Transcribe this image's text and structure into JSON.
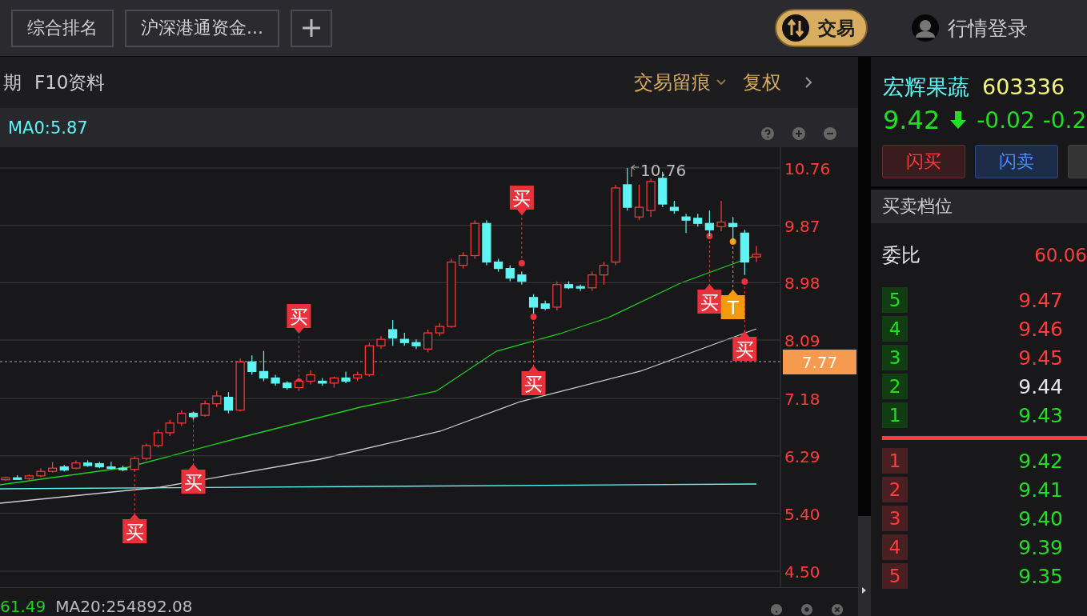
{
  "top_tabs": [
    {
      "label": "综合排名"
    },
    {
      "label": "沪深港通资金..."
    }
  ],
  "trade_button": {
    "label": "交易"
  },
  "login": {
    "label": "行情登录"
  },
  "toolbar": {
    "left": [
      "期",
      "F10资料"
    ],
    "right": [
      {
        "label": "交易留痕",
        "kind": "dropdown"
      },
      {
        "label": "复权",
        "kind": "plain"
      }
    ]
  },
  "indicator_line": "MA0:5.87",
  "chart": {
    "high_label": "10.76",
    "price_tag": "7.77",
    "markers": [
      {
        "kind": "buy",
        "text": "买"
      },
      {
        "kind": "buy",
        "text": "买"
      },
      {
        "kind": "buy",
        "text": "买"
      },
      {
        "kind": "buy",
        "text": "买"
      },
      {
        "kind": "buy",
        "text": "买"
      },
      {
        "kind": "buy",
        "text": "买"
      },
      {
        "kind": "t",
        "text": "T"
      },
      {
        "kind": "buy",
        "text": "买"
      }
    ],
    "chart_data": {
      "type": "candlestick",
      "grid": true,
      "ylim": [
        4.5,
        10.76
      ],
      "yticks": [
        10.76,
        9.87,
        8.98,
        8.09,
        7.18,
        6.29,
        {
          "value": 5.4,
          "label": "5.40"
        },
        {
          "value": 4.5,
          "label": "4.50"
        }
      ],
      "ohlc": [
        [
          5.92,
          5.97,
          5.9,
          5.95
        ],
        [
          5.95,
          5.99,
          5.93,
          5.93
        ],
        [
          5.94,
          6.0,
          5.92,
          5.98
        ],
        [
          5.98,
          6.1,
          5.96,
          6.05
        ],
        [
          6.05,
          6.2,
          6.03,
          6.1
        ],
        [
          6.12,
          6.15,
          6.05,
          6.07
        ],
        [
          6.1,
          6.22,
          6.08,
          6.18
        ],
        [
          6.18,
          6.22,
          6.12,
          6.14
        ],
        [
          6.17,
          6.2,
          6.1,
          6.12
        ],
        [
          6.12,
          6.2,
          6.08,
          6.1
        ],
        [
          6.1,
          6.14,
          6.05,
          6.08
        ],
        [
          6.08,
          6.28,
          6.05,
          6.25
        ],
        [
          6.25,
          6.48,
          6.22,
          6.45
        ],
        [
          6.45,
          6.7,
          6.42,
          6.65
        ],
        [
          6.65,
          6.85,
          6.6,
          6.8
        ],
        [
          6.8,
          7.0,
          6.75,
          6.95
        ],
        [
          6.95,
          6.98,
          6.85,
          6.9
        ],
        [
          6.92,
          7.15,
          6.9,
          7.1
        ],
        [
          7.1,
          7.3,
          7.05,
          7.22
        ],
        [
          7.2,
          7.28,
          6.95,
          7.0
        ],
        [
          7.0,
          7.8,
          6.98,
          7.75
        ],
        [
          7.75,
          7.85,
          7.55,
          7.6
        ],
        [
          7.6,
          7.92,
          7.45,
          7.5
        ],
        [
          7.5,
          7.55,
          7.38,
          7.42
        ],
        [
          7.42,
          7.45,
          7.32,
          7.35
        ],
        [
          7.35,
          7.5,
          7.3,
          7.45
        ],
        [
          7.45,
          7.62,
          7.4,
          7.55
        ],
        [
          7.45,
          7.5,
          7.38,
          7.42
        ],
        [
          7.42,
          7.52,
          7.35,
          7.5
        ],
        [
          7.5,
          7.6,
          7.42,
          7.45
        ],
        [
          7.5,
          7.6,
          7.45,
          7.55
        ],
        [
          7.55,
          8.05,
          7.52,
          8.0
        ],
        [
          8.0,
          8.15,
          7.95,
          8.1
        ],
        [
          8.25,
          8.4,
          8.0,
          8.12
        ],
        [
          8.1,
          8.2,
          8.0,
          8.05
        ],
        [
          8.05,
          8.1,
          7.95,
          8.0
        ],
        [
          7.95,
          8.25,
          7.9,
          8.2
        ],
        [
          8.2,
          8.35,
          8.15,
          8.3
        ],
        [
          8.3,
          9.35,
          8.28,
          9.3
        ],
        [
          9.25,
          9.45,
          9.2,
          9.4
        ],
        [
          9.4,
          9.95,
          9.35,
          9.9
        ],
        [
          9.9,
          9.95,
          9.25,
          9.3
        ],
        [
          9.3,
          9.35,
          9.15,
          9.2
        ],
        [
          9.2,
          9.25,
          9.0,
          9.05
        ],
        [
          9.1,
          9.15,
          8.95,
          9.0
        ],
        [
          8.75,
          8.8,
          8.5,
          8.6
        ],
        [
          8.65,
          8.7,
          8.55,
          8.58
        ],
        [
          8.6,
          9.0,
          8.55,
          8.95
        ],
        [
          8.95,
          9.0,
          8.88,
          8.9
        ],
        [
          8.92,
          8.95,
          8.85,
          8.9
        ],
        [
          8.9,
          9.15,
          8.85,
          9.1
        ],
        [
          9.1,
          9.3,
          8.95,
          9.25
        ],
        [
          9.3,
          10.5,
          9.25,
          10.45
        ],
        [
          10.5,
          10.76,
          10.1,
          10.15
        ],
        [
          10.0,
          10.5,
          9.95,
          10.15
        ],
        [
          10.1,
          10.6,
          10.0,
          10.55
        ],
        [
          10.6,
          10.7,
          10.15,
          10.2
        ],
        [
          10.15,
          10.25,
          10.05,
          10.1
        ],
        [
          10.0,
          10.05,
          9.75,
          9.95
        ],
        [
          9.98,
          10.05,
          9.85,
          9.9
        ],
        [
          9.9,
          10.1,
          9.7,
          9.8
        ],
        [
          9.85,
          10.25,
          9.78,
          9.92
        ],
        [
          9.9,
          10.0,
          9.6,
          9.85
        ],
        [
          9.75,
          9.8,
          9.1,
          9.3
        ],
        [
          9.38,
          9.55,
          9.3,
          9.42
        ]
      ]
    }
  },
  "bottom_indicator": {
    "value": "61.49",
    "ma20": "MA20:254892.08"
  },
  "quote": {
    "name": "宏辉果蔬",
    "code": "603336",
    "price": "9.42",
    "change": "-0.02",
    "change_pct": "-0.2"
  },
  "buttons": [
    {
      "label": "闪买",
      "kind": "buy"
    },
    {
      "label": "闪卖",
      "kind": "sell"
    },
    {
      "kind": "more"
    }
  ],
  "order_book": {
    "title": "买卖档位",
    "ratio_label": "委比",
    "ratio": "60.06",
    "asks": [
      {
        "rank": "5",
        "price": "9.47",
        "color": "#ff3b3b"
      },
      {
        "rank": "4",
        "price": "9.46",
        "color": "#ff3b3b"
      },
      {
        "rank": "3",
        "price": "9.45",
        "color": "#ff3b3b"
      },
      {
        "rank": "2",
        "price": "9.44",
        "color": "#e8e8e8"
      },
      {
        "rank": "1",
        "price": "9.43",
        "color": "#1fe01f"
      }
    ],
    "bids": [
      {
        "rank": "1",
        "price": "9.42",
        "color": "#1fe01f"
      },
      {
        "rank": "2",
        "price": "9.41",
        "color": "#1fe01f"
      },
      {
        "rank": "3",
        "price": "9.40",
        "color": "#1fe01f"
      },
      {
        "rank": "4",
        "price": "9.39",
        "color": "#1fe01f"
      },
      {
        "rank": "5",
        "price": "9.35",
        "color": "#1fe01f"
      }
    ]
  }
}
